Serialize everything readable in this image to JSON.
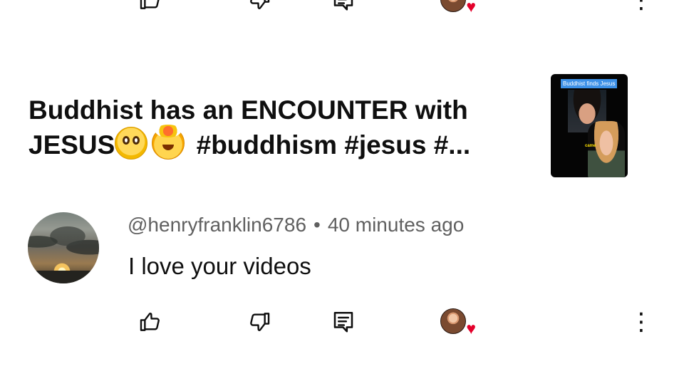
{
  "top_actions": {
    "like_icon": "thumb-up-icon",
    "dislike_icon": "thumb-down-icon",
    "reply_icon": "comment-icon",
    "creator_heart_icon": "heart-icon",
    "more_icon": "more-vertical-icon",
    "heart_symbol": "♥",
    "more_symbol": "⋮"
  },
  "video": {
    "title_part_1": "Buddhist has an ENCOUNTER with",
    "title_part_2": "JESUS",
    "title_emoji_1": "flushed-face-emoji",
    "title_emoji_2": "exploding-head-emoji",
    "title_hashtags": "#buddhism #jesus #...",
    "thumbnail_caption": "Buddhist finds Jesus",
    "thumbnail_word": "came"
  },
  "comment": {
    "author": "@henryfranklin6786",
    "separator": "•",
    "time": "40 minutes ago",
    "text": "I love your videos"
  },
  "bottom_actions": {
    "like_icon": "thumb-up-icon",
    "dislike_icon": "thumb-down-icon",
    "reply_icon": "comment-icon",
    "creator_heart_icon": "heart-icon",
    "more_icon": "more-vertical-icon",
    "heart_symbol": "♥",
    "more_symbol": "⋮"
  }
}
